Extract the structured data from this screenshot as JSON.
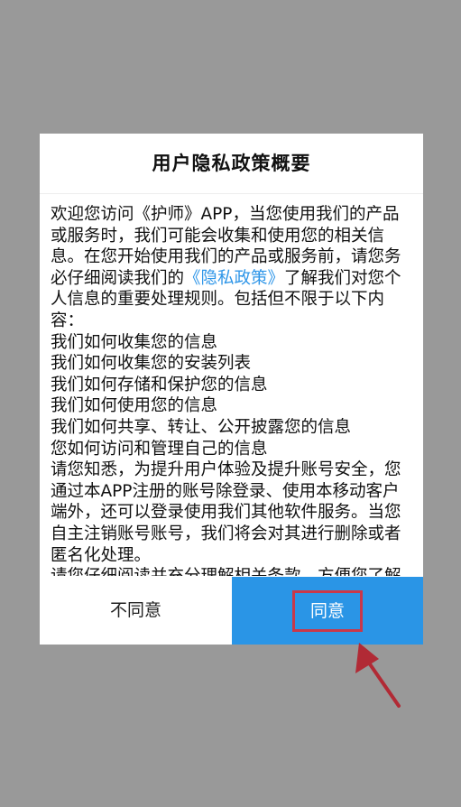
{
  "dialog": {
    "title": "用户隐私政策概要",
    "intro_before_link": "欢迎您访问《护师》APP，当您使用我们的产品或服务时，我们可能会收集和使用您的相关信息。在您开始使用我们的产品或服务前，请您务必仔细阅读我们的",
    "policy_link": "《隐私政策》",
    "intro_after_link": "了解我们对您个人信息的重要处理规则。包括但不限于以下内容：",
    "items": [
      "我们如何收集您的信息",
      "我们如何收集您的安装列表",
      "我们如何存储和保护您的信息",
      "我们如何使用您的信息",
      "我们如何共享、转让、公开披露您的信息",
      "您如何访问和管理自己的信息"
    ],
    "notice": "请您知悉，为提升用户体验及提升账号安全，您通过本APP注册的账号除登录、使用本移动客户端外，还可以登录使用我们其他软件服务。当您自主注销账号账号，我们将会对其进行删除或者匿名化处理。",
    "closing": "请您仔细阅读并充分理解相关条款，方便您了解自己的权利和义务",
    "disagree_label": "不同意",
    "agree_label": "同意"
  },
  "colors": {
    "overlay": "#999999",
    "accent": "#2a95e6",
    "highlight": "#c9384a",
    "link": "#2f96e8"
  }
}
